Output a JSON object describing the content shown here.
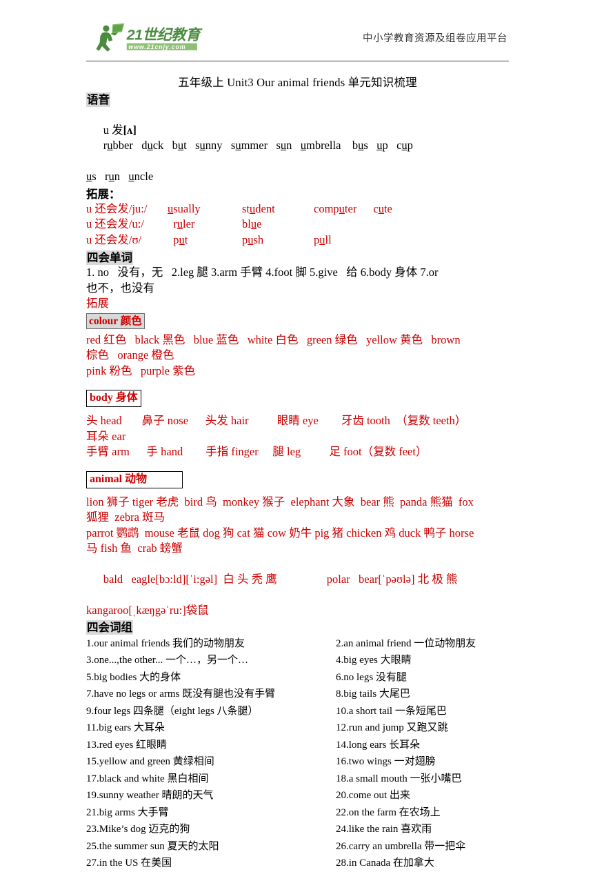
{
  "header": {
    "brand_name": "21世纪教育",
    "brand_url": "www.21cnjy.com",
    "tagline": "中小学教育资源及组卷应用平台",
    "brand_color": "#4a8b3f",
    "brand_dark": "#2f6b2a"
  },
  "doc": {
    "title": "五年级上 Unit3 Our animal friends  单元知识梳理"
  },
  "phonics": {
    "heading": "语音",
    "rule_prefix": "u 发",
    "rule_symbol": "[ʌ]",
    "words_line1": "rubber   duck   but   sunny   summer   sun   umbrella    bus   up   cup",
    "words_line2": "us   run   uncle",
    "expand_heading": "拓展：",
    "rows": [
      {
        "label": "u 还会发/ju:/",
        "words": [
          "usually",
          "student",
          "computer",
          "cute"
        ]
      },
      {
        "label": "u 还会发/u:/",
        "words": [
          "ruler",
          "blue",
          "",
          ""
        ]
      },
      {
        "label": "u 还会发/ʊ/",
        "words": [
          "put",
          "push",
          "pull",
          ""
        ]
      }
    ]
  },
  "four_words": {
    "heading": "四会单词",
    "line1": "1. no   没有，无   2.leg 腿 3.arm 手臂 4.foot 脚 5.give   给 6.body 身体 7.or",
    "line2": "也不，也没有",
    "expand_label": "拓展"
  },
  "colour": {
    "heading": "colour 颜色",
    "line1": "red 红色   black 黑色   blue 蓝色   white 白色   green 绿色   yellow 黄色   brown",
    "line2": "棕色   orange 橙色",
    "line3": "pink 粉色   purple 紫色"
  },
  "body": {
    "heading": "body 身体",
    "line1": "头 head       鼻子 nose      头发 hair          眼睛 eye        牙齿 tooth  （复数 teeth）",
    "line2": "耳朵 ear",
    "line3": "手臂 arm      手 hand        手指 finger     腿 leg          足 foot（复数 feet）"
  },
  "animal": {
    "heading": "animal 动物",
    "line1": "lion 狮子 tiger 老虎  bird 鸟  monkey 猴子  elephant 大象  bear 熊  panda 熊猫  fox",
    "line2": "狐狸  zebra 斑马",
    "line3": "parrot 鹦鹉  mouse 老鼠 dog 狗 cat 猫 cow 奶牛 pig 猪 chicken 鸡 duck 鸭子 horse",
    "line4": "马 fish 鱼  crab 螃蟹",
    "line5_left": "bald   eagle[bɔ:ld][ˈi:gəl]  白 头 秃 鹰",
    "line5_right": "polar   bear[ˈpəʊlə] 北 极 熊",
    "line6": "kangaroo[ˌkæŋgəˈru:]袋鼠"
  },
  "phrases": {
    "heading": "四会词组",
    "items": [
      {
        "left": "1.our animal friends  我们的动物朋友",
        "right": "2.an animal friend  一位动物朋友"
      },
      {
        "left": "3.one...,the other...  一个…，另一个…",
        "right": "4.big eyes  大眼睛"
      },
      {
        "left": "5.big bodies 大的身体",
        "right": " 6.no legs  没有腿"
      },
      {
        "left": "7.have no legs or arms  既没有腿也没有手臂",
        "right": "8.big tails 大尾巴"
      },
      {
        "left": "9.four legs  四条腿（eight legs  八条腿）",
        "right": "10.a short tail  一条短尾巴"
      },
      {
        "left": "11.big ears  大耳朵",
        "right": "12.run and jump  又跑又跳"
      },
      {
        "left": "13.red eyes  红眼睛",
        "right": " 14.long ears  长耳朵"
      },
      {
        "left": "15.yellow and green 黄绿相间",
        "right": "16.two wings  一对翅膀"
      },
      {
        "left": "17.black and white 黑白相间",
        "right": "18.a small mouth 一张小嘴巴"
      },
      {
        "left": "19.sunny weather 晴朗的天气",
        "right": "20.come out 出来"
      },
      {
        "left": "21.big arms  大手臂",
        "right": "22.on the farm 在农场上"
      },
      {
        "left": "23.Mike’s dog  迈克的狗",
        "right": " 24.like the rain  喜欢雨"
      },
      {
        "left": "25.the summer sun  夏天的太阳",
        "right": " 26.carry an umbrella 带一把伞"
      },
      {
        "left": "27.in the US 在美国",
        "right": "   28.in Canada  在加拿大"
      }
    ]
  }
}
